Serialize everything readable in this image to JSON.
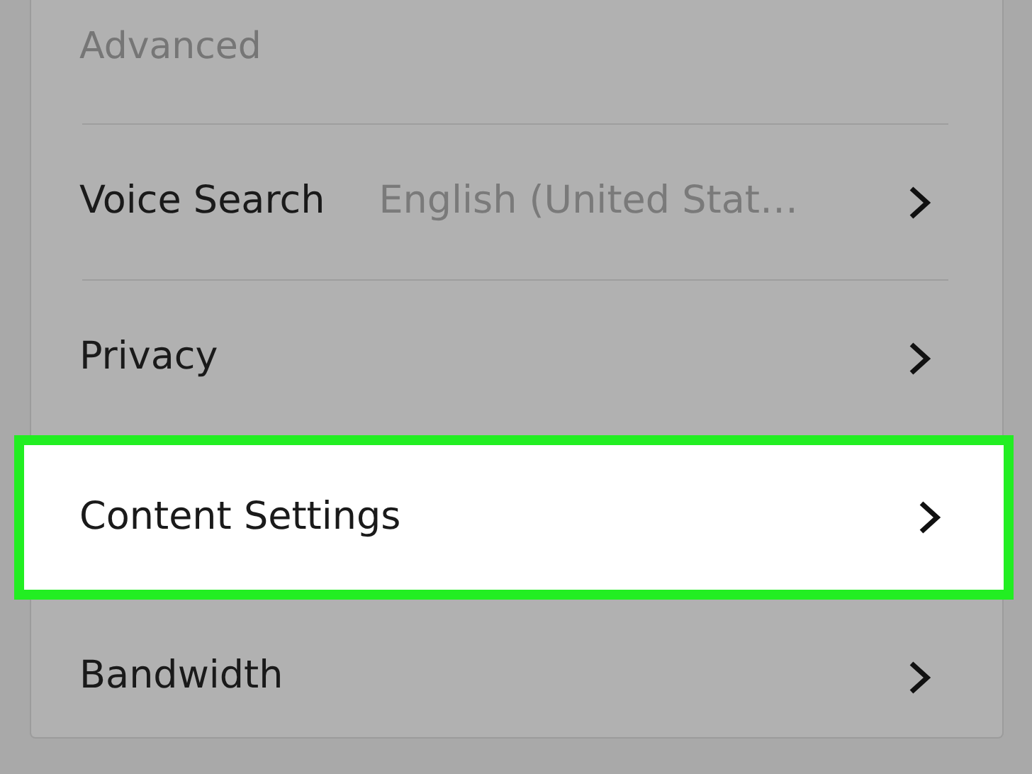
{
  "section_header": "Advanced",
  "items": [
    {
      "label": "Voice Search",
      "value": "English (United Stat…",
      "selected": false
    },
    {
      "label": "Privacy",
      "selected": false
    },
    {
      "label": "Content Settings",
      "selected": true
    },
    {
      "label": "Bandwidth",
      "selected": false
    }
  ]
}
